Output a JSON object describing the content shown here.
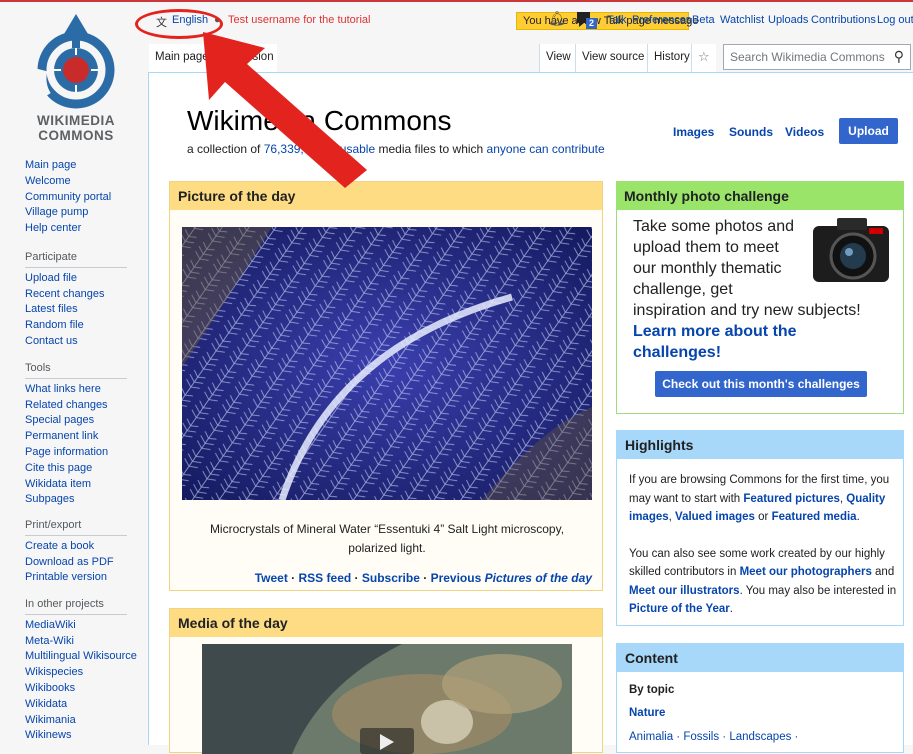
{
  "logo": {
    "line1": "WIKIMEDIA",
    "line2": "COMMONS"
  },
  "personal_tools": {
    "language": "English",
    "username": "Test username for the tutorial",
    "talk_message": "You have a new Talk page message",
    "notif_count": "2",
    "links": [
      "Talk",
      "Preferences",
      "Beta",
      "Watchlist",
      "Uploads",
      "Contributions",
      "Log out"
    ]
  },
  "tabs": {
    "main_page": "Main page",
    "discussion": "Discussion",
    "view": "View",
    "view_source": "View source",
    "history": "History"
  },
  "search": {
    "placeholder": "Search Wikimedia Commons"
  },
  "page": {
    "title": "Wikimedia Commons",
    "subtitle_pre": "a collection of ",
    "count": "76,339,",
    "subtitle_freely": "freely usable",
    "subtitle_mid": " media files to which ",
    "subtitle_anyone": "anyone can contribute"
  },
  "toplinks": {
    "images": "Images",
    "sounds": "Sounds",
    "videos": "Videos",
    "upload": "Upload"
  },
  "potd": {
    "heading": "Picture of the day",
    "caption": "Microcrystals of Mineral Water “Essentuki 4” Salt Light microscopy, polarized light.",
    "tweet": "Tweet",
    "rss": "RSS feed",
    "subscribe": "Subscribe",
    "previous": "Previous",
    "previous_em": "Pictures of the day",
    "sep": " · "
  },
  "motd": {
    "heading": "Media of the day"
  },
  "mpc": {
    "heading": "Monthly photo challenge",
    "line1": "Take some photos and",
    "line2": "upload them to meet",
    "line3": "our monthly thematic",
    "line4": "challenge, get",
    "line5": "inspiration and try new subjects!",
    "learn1": "Learn more about the",
    "learn2": "challenges!",
    "button": "Check out this month's challenges"
  },
  "highlights": {
    "heading": "Highlights",
    "p1_a": "If you are browsing Commons for the first time, you may want to start with ",
    "p1_featured": "Featured pictures",
    "p1_comma": ", ",
    "p1_quality": "Quality images",
    "p1_valued": "Valued images",
    "p1_or": " or ",
    "p1_media": "Featured media",
    "p1_end": ".",
    "p2_a": "You can also see some work created by our highly skilled contributors in ",
    "p2_photogs": "Meet our photographers",
    "p2_and": " and ",
    "p2_illus": "Meet our illustrators",
    "p2_b": ". You may also be interested in ",
    "p2_poty": "Picture of the Year",
    "p2_end": "."
  },
  "content_box": {
    "heading": "Content",
    "by_topic": "By topic",
    "nature": "Nature",
    "line": "Animalia · Fossils · Landscapes ·"
  },
  "sidebar": {
    "nav": [
      "Main page",
      "Welcome",
      "Community portal",
      "Village pump",
      "Help center"
    ],
    "participate": {
      "heading": "Participate",
      "items": [
        "Upload file",
        "Recent changes",
        "Latest files",
        "Random file",
        "Contact us"
      ]
    },
    "tools": {
      "heading": "Tools",
      "items": [
        "What links here",
        "Related changes",
        "Special pages",
        "Permanent link",
        "Page information",
        "Cite this page",
        "Wikidata item",
        "Subpages"
      ]
    },
    "print": {
      "heading": "Print/export",
      "items": [
        "Create a book",
        "Download as PDF",
        "Printable version"
      ]
    },
    "other": {
      "heading": "In other projects",
      "items": [
        "MediaWiki",
        "Meta-Wiki",
        "Multilingual Wikisource",
        "Wikispecies",
        "Wikibooks",
        "Wikidata",
        "Wikimania",
        "Wikinews"
      ]
    }
  },
  "colors": {
    "annotation": "#e3241e",
    "link": "#0645ad",
    "button": "#3366cc"
  }
}
